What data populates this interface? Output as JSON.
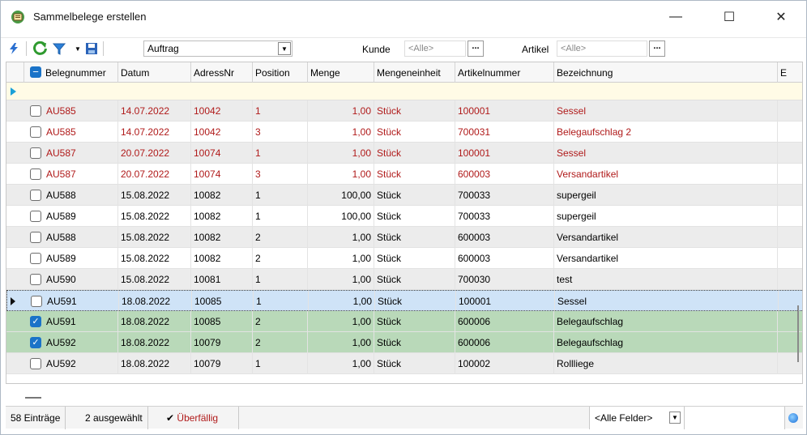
{
  "window": {
    "title": "Sammelbelege erstellen",
    "min_glyph": "—",
    "max_glyph": "☐",
    "close_glyph": "✕"
  },
  "toolbar": {
    "icons": [
      "lightning-icon",
      "refresh-icon",
      "filter-icon",
      "save-icon"
    ],
    "dropdown_arrow": "▼",
    "beleg_type": "Auftrag",
    "kunde_label": "Kunde",
    "kunde_value": "<Alle>",
    "artikel_label": "Artikel",
    "artikel_value": "<Alle>",
    "ellipsis": "..."
  },
  "grid": {
    "columns": [
      "Belegnummer",
      "Datum",
      "AdressNr",
      "Position",
      "Menge",
      "Mengeneinheit",
      "Artikelnummer",
      "Bezeichnung",
      "E"
    ],
    "rows": [
      {
        "beleg": "AU585",
        "datum": "14.07.2022",
        "adress": "10042",
        "pos": "1",
        "menge": "1,00",
        "einheit": "Stück",
        "artikel": "100001",
        "bez": "Sessel",
        "checked": false,
        "overdue": true,
        "state": "normal"
      },
      {
        "beleg": "AU585",
        "datum": "14.07.2022",
        "adress": "10042",
        "pos": "3",
        "menge": "1,00",
        "einheit": "Stück",
        "artikel": "700031",
        "bez": "Belegaufschlag 2",
        "checked": false,
        "overdue": true,
        "state": "normal"
      },
      {
        "beleg": "AU587",
        "datum": "20.07.2022",
        "adress": "10074",
        "pos": "1",
        "menge": "1,00",
        "einheit": "Stück",
        "artikel": "100001",
        "bez": "Sessel",
        "checked": false,
        "overdue": true,
        "state": "normal"
      },
      {
        "beleg": "AU587",
        "datum": "20.07.2022",
        "adress": "10074",
        "pos": "3",
        "menge": "1,00",
        "einheit": "Stück",
        "artikel": "600003",
        "bez": "Versandartikel",
        "checked": false,
        "overdue": true,
        "state": "normal"
      },
      {
        "beleg": "AU588",
        "datum": "15.08.2022",
        "adress": "10082",
        "pos": "1",
        "menge": "100,00",
        "einheit": "Stück",
        "artikel": "700033",
        "bez": "supergeil",
        "checked": false,
        "overdue": false,
        "state": "normal"
      },
      {
        "beleg": "AU589",
        "datum": "15.08.2022",
        "adress": "10082",
        "pos": "1",
        "menge": "100,00",
        "einheit": "Stück",
        "artikel": "700033",
        "bez": "supergeil",
        "checked": false,
        "overdue": false,
        "state": "normal"
      },
      {
        "beleg": "AU588",
        "datum": "15.08.2022",
        "adress": "10082",
        "pos": "2",
        "menge": "1,00",
        "einheit": "Stück",
        "artikel": "600003",
        "bez": "Versandartikel",
        "checked": false,
        "overdue": false,
        "state": "normal"
      },
      {
        "beleg": "AU589",
        "datum": "15.08.2022",
        "adress": "10082",
        "pos": "2",
        "menge": "1,00",
        "einheit": "Stück",
        "artikel": "600003",
        "bez": "Versandartikel",
        "checked": false,
        "overdue": false,
        "state": "normal"
      },
      {
        "beleg": "AU590",
        "datum": "15.08.2022",
        "adress": "10081",
        "pos": "1",
        "menge": "1,00",
        "einheit": "Stück",
        "artikel": "700030",
        "bez": "test",
        "checked": false,
        "overdue": false,
        "state": "normal"
      },
      {
        "beleg": "AU591",
        "datum": "18.08.2022",
        "adress": "10085",
        "pos": "1",
        "menge": "1,00",
        "einheit": "Stück",
        "artikel": "100001",
        "bez": "Sessel",
        "checked": false,
        "overdue": false,
        "state": "current"
      },
      {
        "beleg": "AU591",
        "datum": "18.08.2022",
        "adress": "10085",
        "pos": "2",
        "menge": "1,00",
        "einheit": "Stück",
        "artikel": "600006",
        "bez": "Belegaufschlag",
        "checked": true,
        "overdue": false,
        "state": "selected"
      },
      {
        "beleg": "AU592",
        "datum": "18.08.2022",
        "adress": "10079",
        "pos": "2",
        "menge": "1,00",
        "einheit": "Stück",
        "artikel": "600006",
        "bez": "Belegaufschlag",
        "checked": true,
        "overdue": false,
        "state": "selected"
      },
      {
        "beleg": "AU592",
        "datum": "18.08.2022",
        "adress": "10079",
        "pos": "1",
        "menge": "1,00",
        "einheit": "Stück",
        "artikel": "100002",
        "bez": "Rollliege",
        "checked": false,
        "overdue": false,
        "state": "normal"
      }
    ]
  },
  "statusbar": {
    "entries": "58 Einträge",
    "selected": "2 ausgewählt",
    "overdue_check": "✔",
    "overdue_label": "Überfällig",
    "field_filter": "<Alle Felder>",
    "dropdown_arrow": "▼"
  },
  "colors": {
    "overdue_text": "#b01a1a",
    "row_alt": "#ececec",
    "row_selected": "#b9d9b9",
    "row_current": "#cfe3f7",
    "accent": "#1a73c8"
  }
}
